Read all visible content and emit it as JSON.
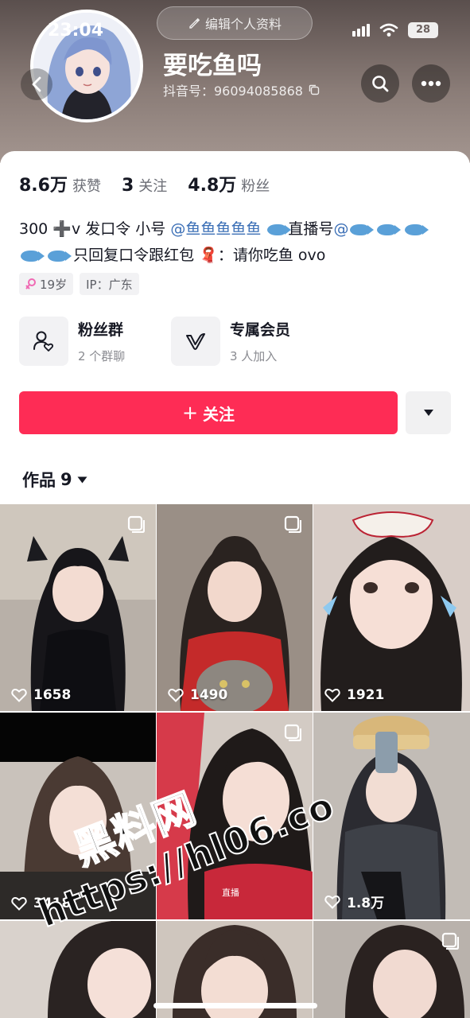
{
  "status_bar": {
    "time": "23:04",
    "battery": "28"
  },
  "header": {
    "edit_profile_label": "编辑个人资料",
    "username": "要吃鱼吗",
    "douyin_id": "抖音号：96094085868"
  },
  "stats": [
    {
      "value": "8.6万",
      "label": "获赞"
    },
    {
      "value": "3",
      "label": "关注"
    },
    {
      "value": "4.8万",
      "label": "粉丝"
    }
  ],
  "bio": {
    "line1_prefix": "300",
    "line1_a": "v 发口令 小号",
    "mention_small": "@鱼鱼鱼鱼鱼",
    "live_label": "直播号",
    "mention_live": "@",
    "line2_text": "只回复口令跟红包",
    "line2_end": "：请你吃鱼 ovo"
  },
  "tags": [
    {
      "icon": "female-icon",
      "text": "19岁"
    },
    {
      "icon": "",
      "text": "IP：广东"
    }
  ],
  "features": [
    {
      "icon": "fan-group-icon",
      "title": "粉丝群",
      "subtitle": "2 个群聊"
    },
    {
      "icon": "vip-check-icon",
      "title": "专属会员",
      "subtitle": "3 人加入"
    }
  ],
  "follow_label": "关注",
  "works_tab": {
    "label": "作品",
    "count": "9"
  },
  "videos": [
    {
      "likes": "1658",
      "multi": true
    },
    {
      "likes": "1490",
      "multi": true
    },
    {
      "likes": "1921",
      "multi": false
    },
    {
      "likes": "3418",
      "multi": false
    },
    {
      "likes": "",
      "multi": true
    },
    {
      "likes": "1.8万",
      "multi": false
    },
    {
      "likes": "",
      "multi": false
    },
    {
      "likes": "",
      "multi": false
    },
    {
      "likes": "",
      "multi": true
    }
  ],
  "tile_overlay_text": "直播",
  "watermark": {
    "line1": "黑料网",
    "line2": "https://hl06.co"
  },
  "colors": {
    "accent": "#fe2c55",
    "mention": "#3b6fb6",
    "header_bg": "#7d706c"
  }
}
